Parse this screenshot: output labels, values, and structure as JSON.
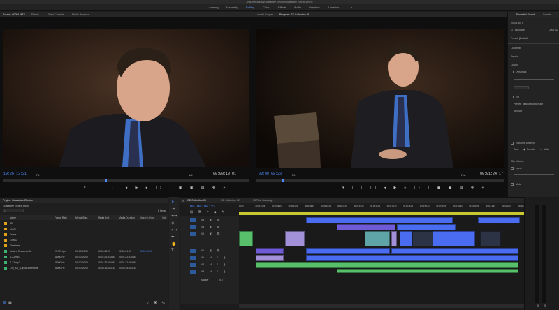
{
  "titlebar": "/Volumes/Media/Guarantee Electric/Guarantee Electric.prproj",
  "workspaces": [
    "Learning",
    "Assembly",
    "Editing",
    "Color",
    "Effects",
    "Audio",
    "Graphics",
    "Libraries"
  ],
  "workspaces_more": "»",
  "source_panel": {
    "tabs": [
      "Source: 00001.MTS",
      "Effects",
      "Effect Controls",
      "Media Browser"
    ],
    "timecode": "19:26:13:21",
    "fit": "Fit",
    "scale": "1/4",
    "duration": "00:00:10:01"
  },
  "program_panel": {
    "tabs": [
      "Lumetri Scopes",
      "Program: GE Collection 01"
    ],
    "timecode": "00:00:08:23",
    "fit": "Fit",
    "scale": "Full",
    "duration": "00:01:24:17"
  },
  "essential_sound": {
    "tabs": [
      "Essential Sound",
      "Lumetri"
    ],
    "clip_name": "00001.MTS",
    "type_label": "Dialogue",
    "clear_audio": "Clear Au",
    "preset_label": "Preset",
    "preset_value": "[Default]",
    "sections": [
      "Loudness",
      "Repair",
      "Clarity"
    ],
    "dynamics": "Dynamics",
    "eq": "EQ",
    "eq_preset_label": "Preset",
    "eq_preset_value": "Background Voice",
    "amount": "Amount",
    "enhance_speech": "Enhance Speech",
    "tone_label": "Tone",
    "tone_female": "Female",
    "tone_male": "Male",
    "clip_volume": "Clip Volume",
    "level": "Level",
    "mute": "Mute"
  },
  "project_panel": {
    "title": "Project: Guarantee Electric",
    "filename": "Guarantee Electric.prproj",
    "item_count": "8 Items",
    "columns": [
      "Name",
      "Frame Rate",
      "Media Start",
      "Media End",
      "Media Duration",
      "Video In Point",
      "Vid"
    ],
    "rows": [
      {
        "name": "B2",
        "fps": "",
        "start": "",
        "end": "",
        "dur": "",
        "in": "",
        "color": "#e0a21a"
      },
      {
        "name": "CLUE",
        "fps": "",
        "start": "",
        "end": "",
        "dur": "",
        "in": "",
        "color": "#e0a21a"
      },
      {
        "name": "Drone",
        "fps": "",
        "start": "",
        "end": "",
        "dur": "",
        "in": "",
        "color": "#e0a21a"
      },
      {
        "name": "GSMO",
        "fps": "",
        "start": "",
        "end": "",
        "dur": "",
        "in": "",
        "color": "#e0a21a"
      },
      {
        "name": "Timelines",
        "fps": "",
        "start": "",
        "end": "",
        "dur": "",
        "in": "",
        "color": "#e0a21a"
      },
      {
        "name": "Nested Sequence 01",
        "fps": "23.976 fps",
        "start": "00:00:00:00",
        "end": "00:00:05:29",
        "dur": "00:00:01:00",
        "in": "00:00:00:00",
        "color": "#3cb371"
      },
      {
        "name": "S-22.mp3",
        "fps": "48000 Hz",
        "start": "00:00:00:00",
        "end": "00:01:22:13468",
        "dur": "00:01:22:13468",
        "in": "",
        "color": "#3cb371"
      },
      {
        "name": "S-22 mp3",
        "fps": "48000 Hz",
        "start": "00:00:00:00",
        "end": "00:01:22:18498",
        "dur": "00:01:22:18498",
        "in": "",
        "color": "#3cb371"
      },
      {
        "name": "L00_full_a-great-adventure",
        "fps": "48000 Hz",
        "start": "00:00:00:00",
        "end": "00:03:16:15318",
        "dur": "00:03:16:15318",
        "in": "",
        "color": "#3cb371"
      }
    ]
  },
  "timeline": {
    "tabs": [
      "GE Collection 01",
      "GE Collection 02",
      "05 Tina Hartsong"
    ],
    "timecode": "00:00:08:23",
    "ruler": [
      "00:00",
      "00:00:04:23",
      "00:00:09:23",
      "00:00:14:23",
      "00:00:19:23",
      "00:00:24:23",
      "00:00:29:23",
      "00:00:34:23",
      "00:00:39:23",
      "00:00:44:23",
      "00:00:49:23",
      "00:00:54:23",
      "00:00:59:23",
      "00:01:04:23",
      "00:01:09:23",
      "00:01:14:23",
      "00:01:19:23",
      "00:01:24:23"
    ],
    "video_tracks": [
      "V4",
      "V3",
      "V2",
      "V1"
    ],
    "audio_tracks": [
      "A1",
      "A2",
      "A3"
    ],
    "master": "Master",
    "master_value": "0.0"
  },
  "colors": {
    "accent_blue": "#4f8cff",
    "clip_purple": "#6f5bd6",
    "clip_blue": "#4a6cf0",
    "clip_green": "#58c06a",
    "clip_lilac": "#a290d8",
    "clip_teal": "#5fa4a6"
  }
}
